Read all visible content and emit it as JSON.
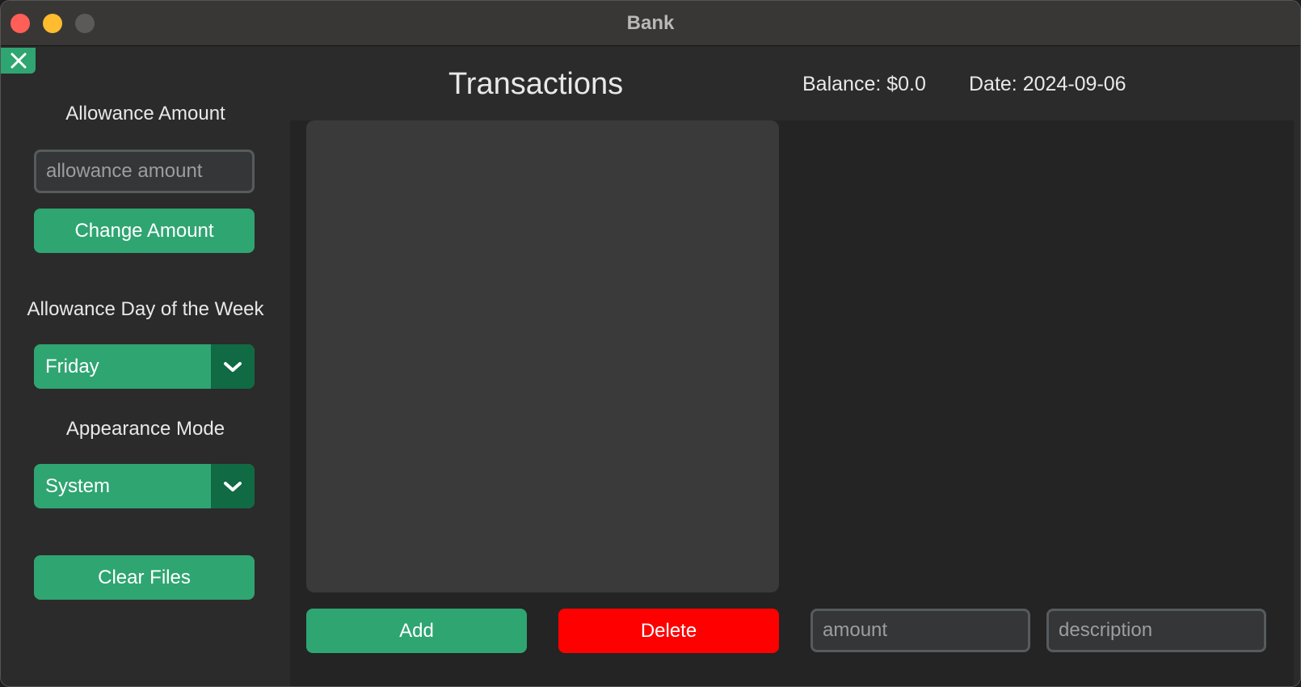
{
  "window": {
    "title": "Bank"
  },
  "header": {
    "title": "Transactions",
    "balance": "Balance: $0.0",
    "date": "Date: 2024-09-06"
  },
  "sidebar": {
    "close_icon": "close-x-icon",
    "allowance_amount_label": "Allowance Amount",
    "allowance_amount_placeholder": "allowance amount",
    "change_amount_label": "Change Amount",
    "allowance_day_label": "Allowance Day of the Week",
    "allowance_day_value": "Friday",
    "appearance_mode_label": "Appearance Mode",
    "appearance_mode_value": "System",
    "clear_files_label": "Clear Files"
  },
  "main": {
    "add_label": "Add",
    "delete_label": "Delete",
    "amount_placeholder": "amount",
    "description_placeholder": "description"
  },
  "colors": {
    "accent_green": "#2fa572",
    "dark_green": "#106a43",
    "delete_red": "#ff0000",
    "panel_bg": "#2b2b2b",
    "content_bg": "#242424",
    "list_bg": "#3a3a3a"
  }
}
